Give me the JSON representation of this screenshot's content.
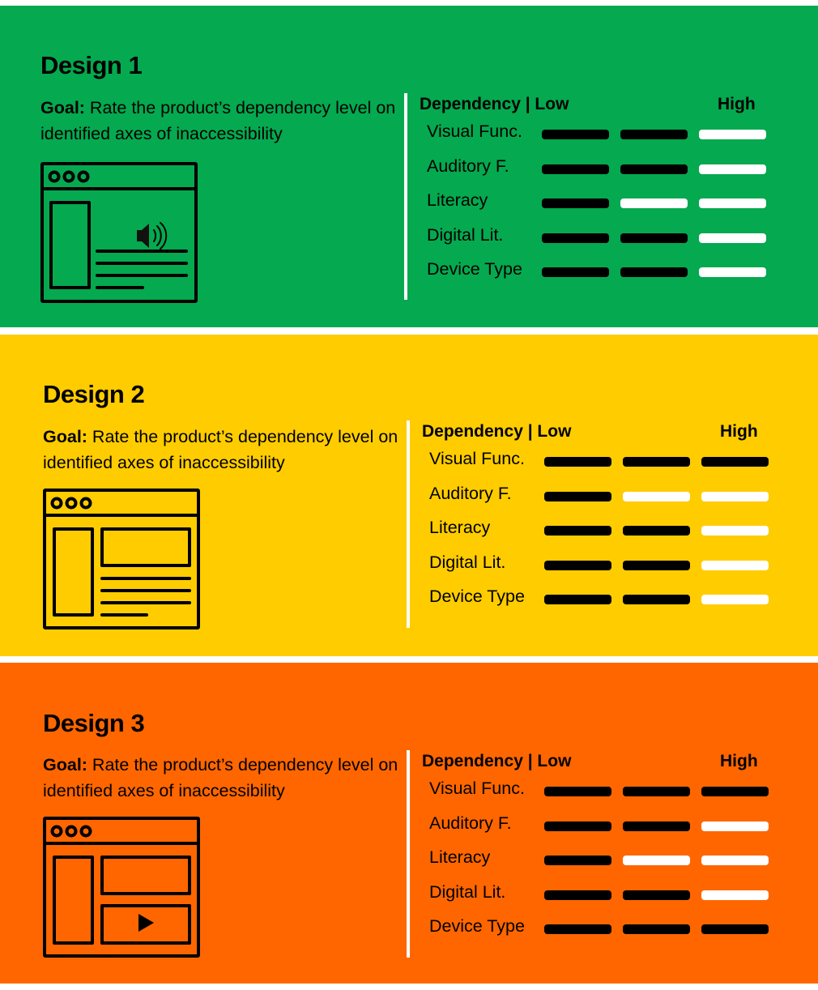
{
  "colors": {
    "design_1": "#05A94F",
    "design_2": "#FFCC00",
    "design_3": "#FF6600",
    "filled_bar": "#000000",
    "empty_bar": "#FFFFFF"
  },
  "scale": {
    "header_label": "Dependency | Low",
    "high_label": "High",
    "levels": 3
  },
  "designs": [
    {
      "title": "Design 1",
      "goal_label": "Goal:",
      "goal_text": " Rate the product’s dependency level on identified axes of inaccessibility",
      "icon": "browser-window-audio-icon",
      "axes": [
        {
          "label": "Visual Func.",
          "level": 2
        },
        {
          "label": "Auditory F.",
          "level": 2
        },
        {
          "label": "Literacy",
          "level": 1
        },
        {
          "label": "Digital Lit.",
          "level": 2
        },
        {
          "label": "Device Type",
          "level": 2
        }
      ]
    },
    {
      "title": "Design 2",
      "goal_label": "Goal:",
      "goal_text": " Rate the product’s dependency level on identified axes of inaccessibility",
      "icon": "browser-window-text-icon",
      "axes": [
        {
          "label": "Visual Func.",
          "level": 3
        },
        {
          "label": "Auditory F.",
          "level": 1
        },
        {
          "label": "Literacy",
          "level": 2
        },
        {
          "label": "Digital Lit.",
          "level": 2
        },
        {
          "label": "Device Type",
          "level": 2
        }
      ]
    },
    {
      "title": "Design 3",
      "goal_label": "Goal:",
      "goal_text": " Rate the product’s dependency level on identified axes of inaccessibility",
      "icon": "browser-window-video-icon",
      "axes": [
        {
          "label": "Visual Func.",
          "level": 3
        },
        {
          "label": "Auditory F.",
          "level": 2
        },
        {
          "label": "Literacy",
          "level": 1
        },
        {
          "label": "Digital Lit.",
          "level": 2
        },
        {
          "label": "Device Type",
          "level": 3
        }
      ]
    }
  ]
}
